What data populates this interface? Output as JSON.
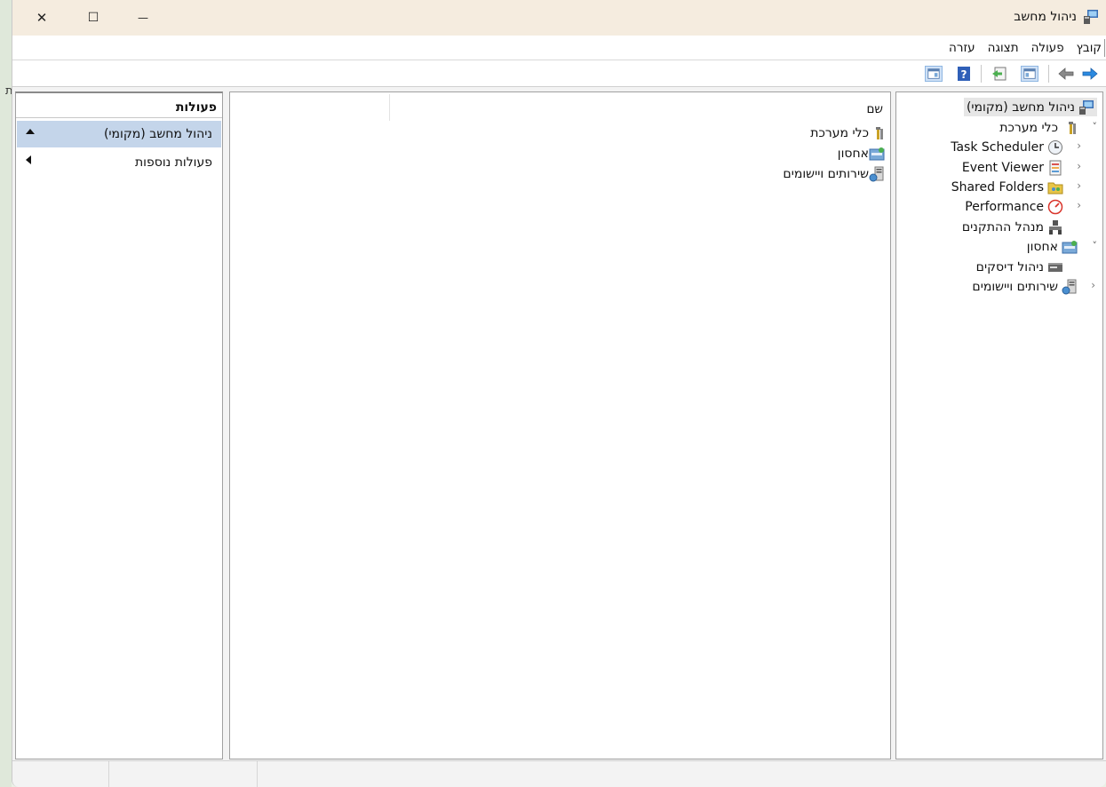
{
  "window": {
    "title": "ניהול מחשב",
    "controls": {
      "close": "✕",
      "maximize": "☐",
      "minimize": "—"
    }
  },
  "menu": {
    "items": [
      "קובץ",
      "פעולה",
      "תצוגה",
      "עזרה"
    ]
  },
  "toolbar": {
    "buttons": [
      "forward-icon",
      "back-icon",
      "show-hide-console-tree-icon",
      "export-list-icon",
      "help-icon",
      "show-hide-action-pane-icon"
    ]
  },
  "tree": {
    "root": "ניהול מחשב (מקומי)",
    "items": [
      {
        "label": "כלי מערכת",
        "icon": "tools-icon",
        "expander": "˅"
      },
      {
        "label": "Task Scheduler",
        "icon": "clock-icon",
        "expander": "‹"
      },
      {
        "label": "Event Viewer",
        "icon": "event-viewer-icon",
        "expander": "‹"
      },
      {
        "label": "Shared Folders",
        "icon": "shared-folders-icon",
        "expander": "‹"
      },
      {
        "label": "Performance",
        "icon": "performance-icon",
        "expander": "‹"
      },
      {
        "label": "מנהל ההתקנים",
        "icon": "device-manager-icon",
        "expander": ""
      },
      {
        "label": "אחסון",
        "icon": "storage-icon",
        "expander": "˅"
      },
      {
        "label": "ניהול דיסקים",
        "icon": "disk-icon",
        "expander": ""
      },
      {
        "label": "שירותים ויישומים",
        "icon": "services-icon",
        "expander": "‹"
      }
    ]
  },
  "content": {
    "column_header": "שם",
    "rows": [
      {
        "label": "כלי מערכת",
        "icon": "tools-icon"
      },
      {
        "label": "אחסון",
        "icon": "storage-icon"
      },
      {
        "label": "שירותים ויישומים",
        "icon": "services-icon"
      }
    ]
  },
  "actions": {
    "header": "פעולות",
    "items": [
      {
        "label": "ניהול מחשב (מקומי)",
        "selected": true,
        "arrow": "up"
      },
      {
        "label": "פעולות נוספות",
        "selected": false,
        "arrow": "left"
      }
    ]
  },
  "outside": {
    "glyph": "ת"
  },
  "colors": {
    "accent": "#1e90d8",
    "selection": "#c4d5ea",
    "titlebar": "#f5ecdf"
  }
}
